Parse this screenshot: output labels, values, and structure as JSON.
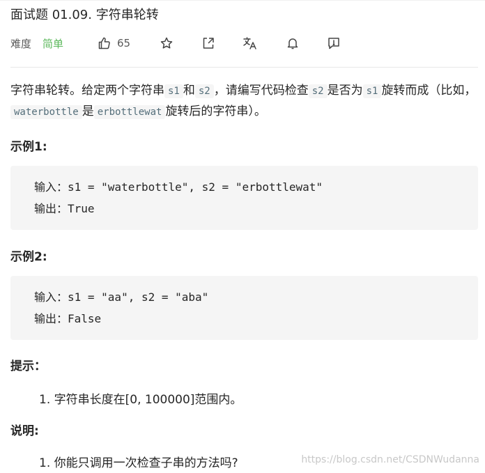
{
  "problem": {
    "title": "面试题 01.09. 字符串轮转",
    "difficulty_label": "难度",
    "difficulty": "简单",
    "difficulty_color": "#5cb85c",
    "likes": "65"
  },
  "icons": {
    "like": "thumbs-up-icon",
    "star": "star-icon",
    "share": "share-icon",
    "translate": "translate-icon",
    "bell": "bell-icon",
    "feedback": "feedback-icon"
  },
  "description": {
    "p1": "字符串轮转。给定两个字符串",
    "s1": "s1",
    "and": "和",
    "s2": "s2",
    "p2": "，请编写代码检查",
    "s2b": "s2",
    "p3": "是否为",
    "s1b": "s1",
    "p4": "旋转而成（比如，",
    "ex_a": "waterbottle",
    "p5": "是",
    "ex_b": "erbottlewat",
    "p6": "旋转后的字符串）。"
  },
  "examples": [
    {
      "heading": "示例1:",
      "input": "输入：s1 = \"waterbottle\", s2 = \"erbottlewat\"",
      "output": "输出：True"
    },
    {
      "heading": "示例2:",
      "input": "输入：s1 = \"aa\", s2 = \"aba\"",
      "output": "输出：False"
    }
  ],
  "hints": {
    "heading": "提示：",
    "items": [
      "1. 字符串长度在[0, 100000]范围内。"
    ]
  },
  "notes": {
    "heading": "说明:",
    "items": [
      "1. 你能只调用一次检查子串的方法吗?"
    ]
  },
  "watermark": "https://blog.csdn.net/CSDNWudanna"
}
